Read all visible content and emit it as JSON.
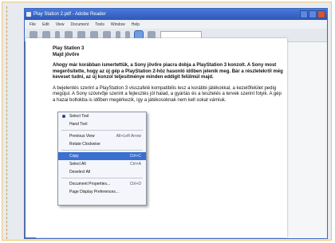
{
  "window": {
    "title": "Play Station 2.pdf - Adobe Reader"
  },
  "menubar": [
    "File",
    "Edit",
    "View",
    "Document",
    "Tools",
    "Window",
    "Help"
  ],
  "document": {
    "heading": "Play Station 3",
    "subheading": "Majd jövőre",
    "intro": "Ahogy már korábban ismertettük, a Sony jövőre piacra dobja a PlayStation 3 konzolt. A Sony most megerősítette, hogy az új gép a PlayStation 2-höz hasonló időben jelenik meg. Bár a részletekről még keveset tudni, az új konzol teljesítménye minden eddigit felülmúl majd.",
    "body": "A bejelentés szerint a PlayStation 3 visszafelé kompatibilis lesz a korábbi játékokkal, a kezelőfelület pedig megújul. A Sony szóvivője szerint a fejlesztés jól halad, a gyártás és a tesztelés a tervek szerint folyik. A gép a hazai boltokba is időben megérkezik, így a játékosoknak nem kell sokat várniuk."
  },
  "context_menu": {
    "items": [
      {
        "label": "Select Tool",
        "shortcut": ""
      },
      {
        "label": "Hand Tool",
        "shortcut": ""
      },
      {
        "label": "Previous View",
        "shortcut": "Alt+Left Arrow"
      },
      {
        "label": "Rotate Clockwise",
        "shortcut": ""
      },
      {
        "label": "Copy",
        "shortcut": "Ctrl+C"
      },
      {
        "label": "Select All",
        "shortcut": "Ctrl+A"
      },
      {
        "label": "Deselect All",
        "shortcut": ""
      },
      {
        "label": "Document Properties...",
        "shortcut": "Ctrl+D"
      },
      {
        "label": "Page Display Preferences...",
        "shortcut": ""
      }
    ]
  }
}
